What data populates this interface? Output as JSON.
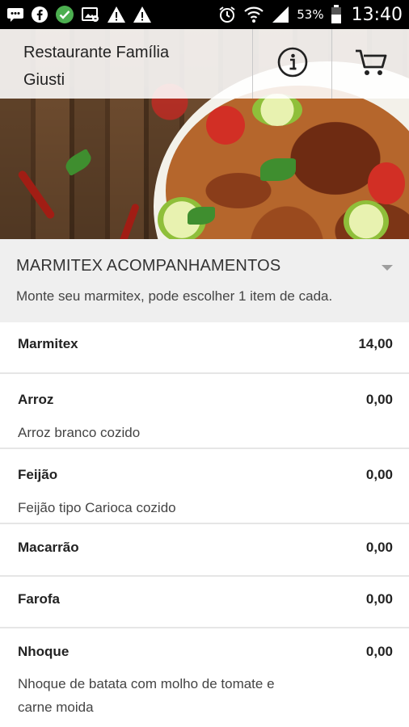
{
  "status_bar": {
    "battery_percent": "53%",
    "time": "13:40",
    "icons": [
      "message-icon",
      "facebook-icon",
      "check-circle-icon",
      "image-icon",
      "warning-icon",
      "warning-icon",
      "alarm-icon",
      "wifi-icon",
      "signal-icon",
      "battery-icon"
    ]
  },
  "header": {
    "title_line1": "Restaurante Família",
    "title_line2": "Giusti",
    "info_icon": "info-icon",
    "cart_icon": "cart-icon"
  },
  "section": {
    "title": "MARMITEX ACOMPANHAMENTOS",
    "subtitle": "Monte seu marmitex, pode escolher 1 item de cada."
  },
  "items": [
    {
      "name": "Marmitex",
      "price": "14,00",
      "desc": []
    },
    {
      "name": "Arroz",
      "price": "0,00",
      "desc": [
        "Arroz branco cozido"
      ]
    },
    {
      "name": "Feijão",
      "price": "0,00",
      "desc": [
        "Feijão tipo Carioca cozido"
      ]
    },
    {
      "name": "Macarrão",
      "price": "0,00",
      "desc": []
    },
    {
      "name": "Farofa",
      "price": "0,00",
      "desc": []
    },
    {
      "name": "Nhoque",
      "price": "0,00",
      "desc": [
        "Nhoque de batata com molho de tomate e",
        "carne moida"
      ]
    }
  ]
}
